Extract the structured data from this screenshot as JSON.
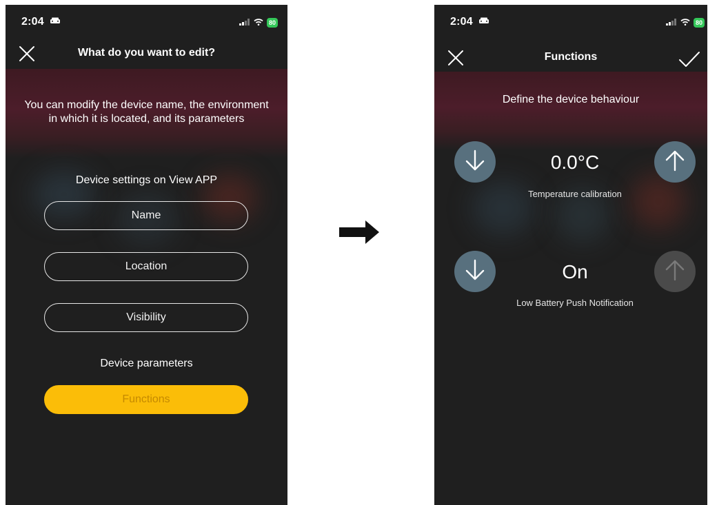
{
  "left_screen": {
    "status": {
      "time": "2:04",
      "battery": "80"
    },
    "nav": {
      "title": "What do you want to edit?"
    },
    "intro": {
      "line1": "You can modify the device name, the environment",
      "line2": "in which it is located, and its parameters"
    },
    "device_settings": {
      "heading": "Device settings on View APP",
      "name_label": "Name",
      "location_label": "Location",
      "visibility_label": "Visibility"
    },
    "device_parameters": {
      "heading": "Device parameters",
      "functions_label": "Functions"
    }
  },
  "right_screen": {
    "status": {
      "time": "2:04",
      "battery": "80"
    },
    "nav": {
      "title": "Functions"
    },
    "intro": "Define the device behaviour",
    "temperature": {
      "value": "0.0°C",
      "caption": "Temperature calibration"
    },
    "low_battery": {
      "value": "On",
      "caption": "Low Battery Push Notification"
    }
  },
  "colors": {
    "background": "#1f1f1f",
    "accent_yellow": "#fbbd08",
    "button_blue_gray": "#58707e",
    "button_disabled": "#4a4a4a"
  }
}
